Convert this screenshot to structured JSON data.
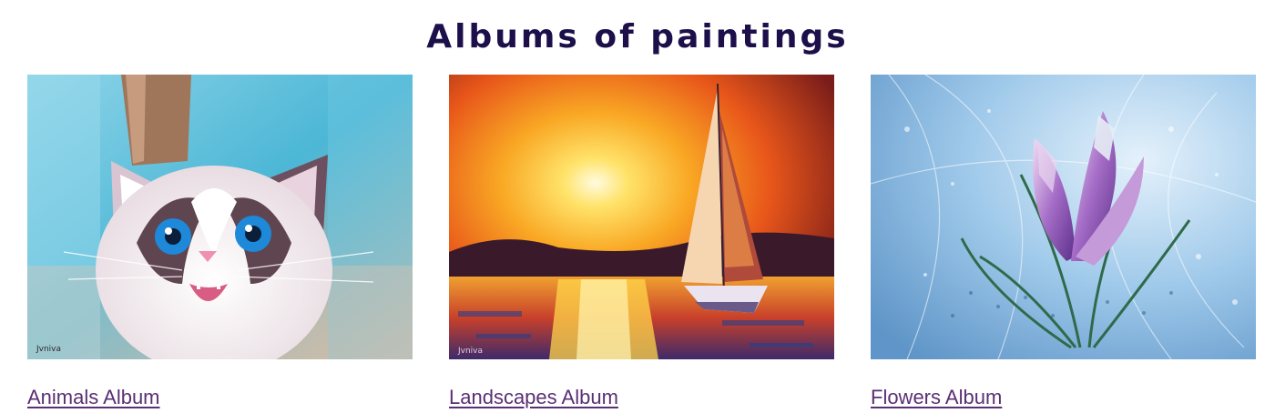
{
  "page": {
    "title": "Albums of paintings"
  },
  "albums": [
    {
      "label": "Animals Album",
      "image": "cat-painting-thumbnail"
    },
    {
      "label": "Landscapes Album",
      "image": "sunset-sailboat-painting-thumbnail"
    },
    {
      "label": "Flowers Album",
      "image": "crocus-flower-painting-thumbnail"
    }
  ],
  "colors": {
    "title": "#1c0f4a",
    "link": "#5a2f73"
  }
}
